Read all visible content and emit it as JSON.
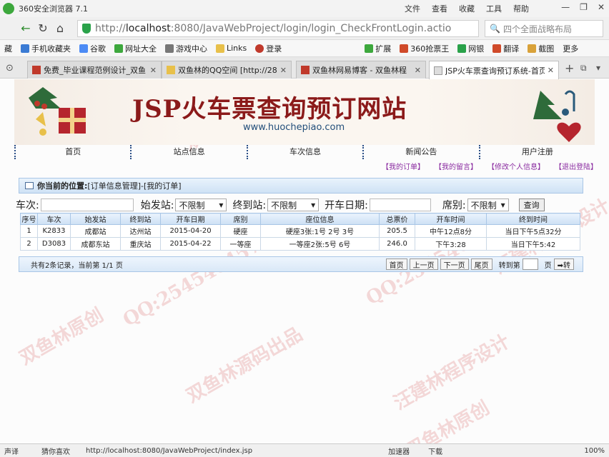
{
  "browser": {
    "app_title": "360安全浏览器 7.1",
    "menus": [
      "文件",
      "查看",
      "收藏",
      "工具",
      "帮助"
    ],
    "url_prefix": "http://",
    "url_host": "localhost",
    "url_rest": ":8080/JavaWebProject/login/login_CheckFrontLogin.actio",
    "search_placeholder": "四个全面战略布局",
    "favorites": [
      "藏",
      "手机收藏夹",
      "谷歌",
      "网址大全",
      "游戏中心",
      "Links",
      "登录",
      "扩展",
      "360抢票王",
      "网银",
      "翻译",
      "截图",
      "更多"
    ],
    "tabs": [
      {
        "label": "免费_毕业课程范例设计_双鱼"
      },
      {
        "label": "双鱼林的QQ空间 [http://28"
      },
      {
        "label": "双鱼林网易博客 - 双鱼林程"
      },
      {
        "label": "JSP火车票查询预订系统-首页"
      }
    ]
  },
  "site": {
    "title": "JSP火车票查询预订网站",
    "domain": "www.huochepiao.com",
    "nav": [
      "首页",
      "站点信息",
      "车次信息",
      "新闻公告",
      "用户注册"
    ],
    "user_links": [
      "【我的订单】",
      "【我的留言】",
      "【修改个人信息】",
      "【退出登陆】"
    ],
    "crumb_label": "你当前的位置:",
    "crumb_path": "[订单信息管理]-[我的订单]"
  },
  "filter": {
    "train_label": "车次:",
    "start_label": "始发站:",
    "start_value": "不限制",
    "end_label": "终到站:",
    "end_value": "不限制",
    "date_label": "开车日期:",
    "seat_label": "席别:",
    "seat_value": "不限制",
    "query_label": "查询"
  },
  "table": {
    "headers": [
      "序号",
      "车次",
      "始发站",
      "终到站",
      "开车日期",
      "席别",
      "座位信息",
      "总票价",
      "开车时间",
      "终到时间"
    ],
    "rows": [
      [
        "1",
        "K2833",
        "成都站",
        "达州站",
        "2015-04-20",
        "硬座",
        "硬座3张:1号 2号 3号",
        "205.5",
        "中午12点8分",
        "当日下午5点32分"
      ],
      [
        "2",
        "D3083",
        "成都东站",
        "重庆站",
        "2015-04-22",
        "一等座",
        "一等座2张:5号 6号",
        "246.0",
        "下午3:28",
        "当日下午5:42"
      ]
    ]
  },
  "pager": {
    "summary": "共有2条记录，当前第 1/1 页",
    "first": "首页",
    "prev": "上一页",
    "next": "下一页",
    "last": "尾页",
    "jump_label": "转到第",
    "page_unit": "页",
    "go": "➡转"
  },
  "statusbar": {
    "left": "声译",
    "guess": "猜你喜欢",
    "url": "http://localhost:8080/JavaWebProject/index.jsp",
    "accel": "加速器",
    "download": "下载",
    "zoom": "100%"
  },
  "watermarks": [
    "双鱼林原创",
    "QQ:254540457",
    "双鱼林源码出品",
    "汪建林程序设计",
    "双鱼林原创",
    "QQ:254540457",
    "双鱼林原创",
    "汪建林程序设计"
  ]
}
